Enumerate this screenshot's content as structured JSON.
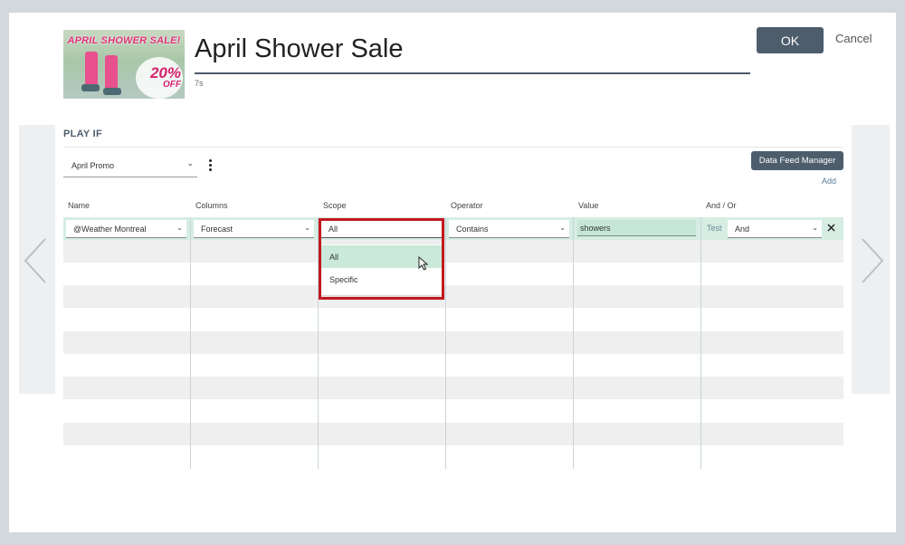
{
  "header": {
    "title": "April Shower Sale",
    "duration": "7s",
    "thumbnail": {
      "banner_text": "APRIL SHOWER SALE!",
      "discount": "20%",
      "discount_suffix": "OFF"
    },
    "ok_label": "OK",
    "cancel_label": "Cancel"
  },
  "play_if": {
    "heading": "PLAY IF",
    "promo_select_value": "April Promo",
    "data_feed_manager_label": "Data Feed Manager",
    "add_label": "Add"
  },
  "table": {
    "columns": [
      "Name",
      "Columns",
      "Scope",
      "Operator",
      "Value",
      "And / Or"
    ],
    "rule": {
      "name": "@Weather Montreal",
      "column": "Forecast",
      "scope": "All",
      "operator": "Contains",
      "value": "showers",
      "test_label": "Test",
      "and_or": "And"
    }
  },
  "scope_dropdown": {
    "options": [
      "All",
      "Specific"
    ],
    "selected": "All"
  },
  "colors": {
    "accent": "#4d5d6c",
    "active_row": "#d5ede2",
    "highlight": "#c21820",
    "value_fill": "#c6e7d8"
  },
  "icons": {
    "prev": "chevron-left-icon",
    "next": "chevron-right-icon",
    "menu": "kebab-menu-icon",
    "remove": "close-icon",
    "cursor": "mouse-pointer-icon"
  }
}
